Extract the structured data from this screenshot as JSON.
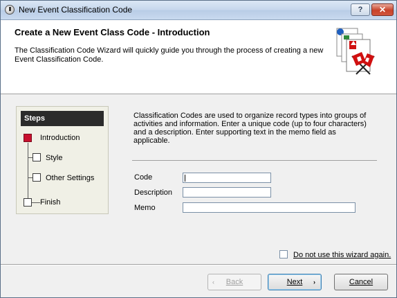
{
  "window": {
    "title": "New Event Classification Code",
    "help_label": "?",
    "close_label": "✕"
  },
  "header": {
    "title": "Create a New Event Class Code - Introduction",
    "description": "The Classification Code Wizard will quickly guide you through the process of creating a new Event Classification Code."
  },
  "steps": {
    "heading": "Steps",
    "items": [
      {
        "label": "Introduction",
        "current": true
      },
      {
        "label": "Style",
        "current": false
      },
      {
        "label": "Other Settings",
        "current": false
      },
      {
        "label": "Finish",
        "current": false
      }
    ]
  },
  "content": {
    "description": "Classification Codes are used to organize record types into groups of activities and information.  Enter a unique code (up to four characters) and a description.  Enter supporting text in the memo field as applicable.",
    "fields": {
      "code_label": "Code",
      "code_value": "",
      "description_label": "Description",
      "description_value": "",
      "memo_label": "Memo",
      "memo_value": ""
    },
    "dont_use_label": "Do not use this wizard again.",
    "dont_use_checked": false
  },
  "buttons": {
    "back_arrow": "‹",
    "back_label": "Back",
    "next_label": "Next",
    "next_arrow": "›",
    "cancel_label": "Cancel"
  },
  "icons": {
    "app": "app-clock-icon",
    "header": "event-flags-icon"
  }
}
